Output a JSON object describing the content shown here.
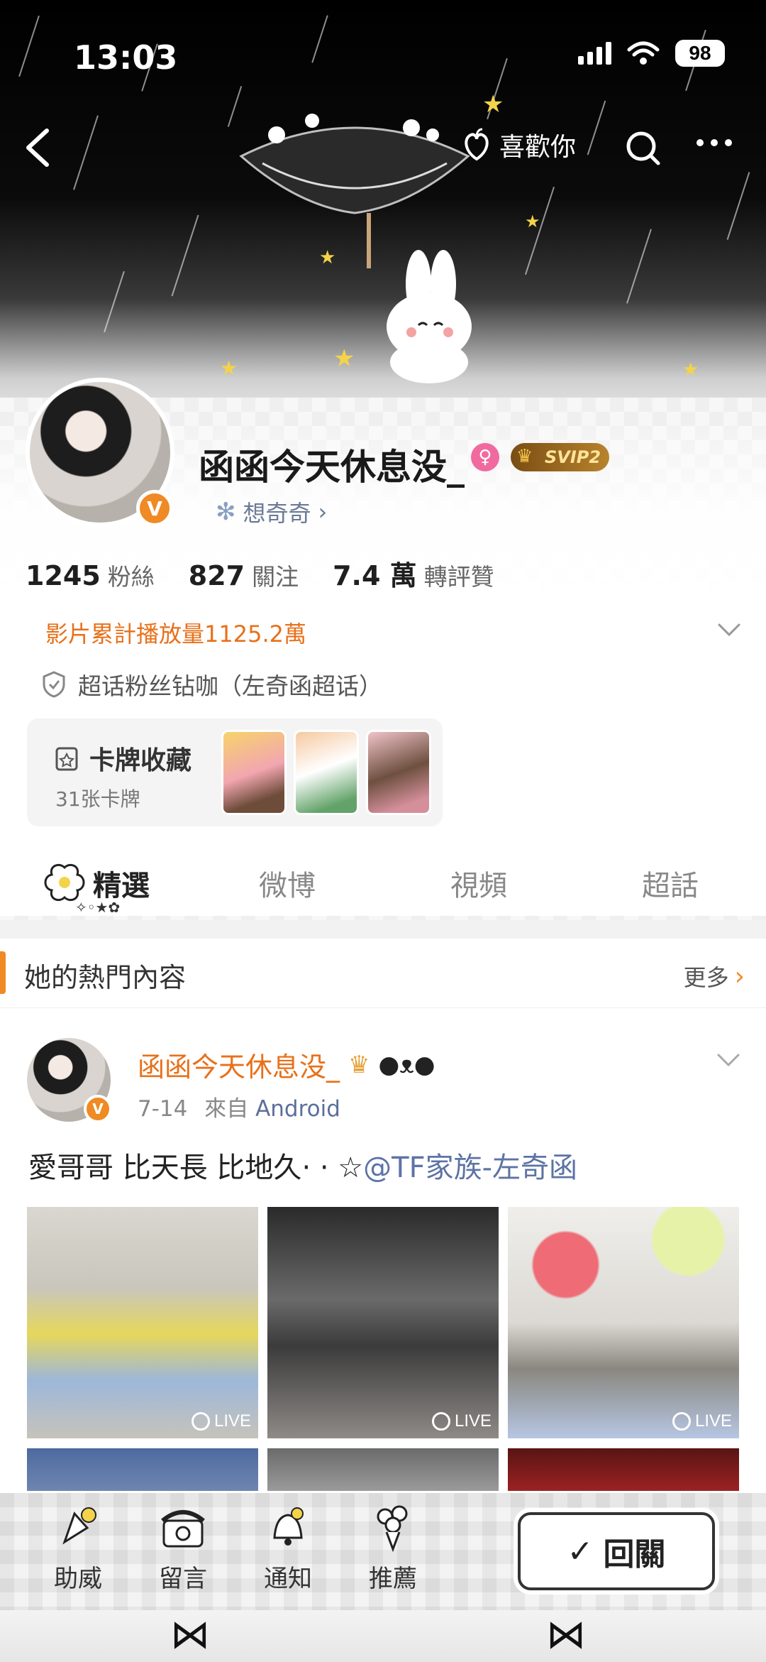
{
  "status_bar": {
    "time": "13:03",
    "battery": "98"
  },
  "header": {
    "like_label": "喜歡你"
  },
  "profile": {
    "username": "函函今天休息没_",
    "vip_label": "SVIP2",
    "fan_group": "想奇奇",
    "stats": [
      {
        "value": "1245",
        "label": "粉絲"
      },
      {
        "value": "827",
        "label": "關注"
      },
      {
        "value": "7.4 萬",
        "label": "轉評贊"
      }
    ],
    "play_count": "影片累計播放量1125.2萬",
    "superfan": "超话粉丝钻咖（左奇函超话）",
    "cards": {
      "title": "卡牌收藏",
      "count": "31张卡牌"
    }
  },
  "tabs": [
    {
      "label": "精選",
      "active": true
    },
    {
      "label": "微博",
      "active": false
    },
    {
      "label": "視頻",
      "active": false
    },
    {
      "label": "超話",
      "active": false
    }
  ],
  "hot": {
    "title": "她的熱門內容",
    "more": "更多"
  },
  "post": {
    "author": "函函今天休息没_",
    "date": "7-14",
    "source_prefix": "來自",
    "source": "Android",
    "text": "愛哥哥 比天長 比地久",
    "text_symbols": "·  ·  ☆",
    "mention": "@TF家族-左奇函",
    "live_label": "LIVE"
  },
  "bottom_bar": {
    "items": [
      "助威",
      "留言",
      "通知",
      "推薦"
    ],
    "return_label": "回關"
  },
  "colors": {
    "accent": "#f08a24",
    "link": "#5d73a6"
  }
}
